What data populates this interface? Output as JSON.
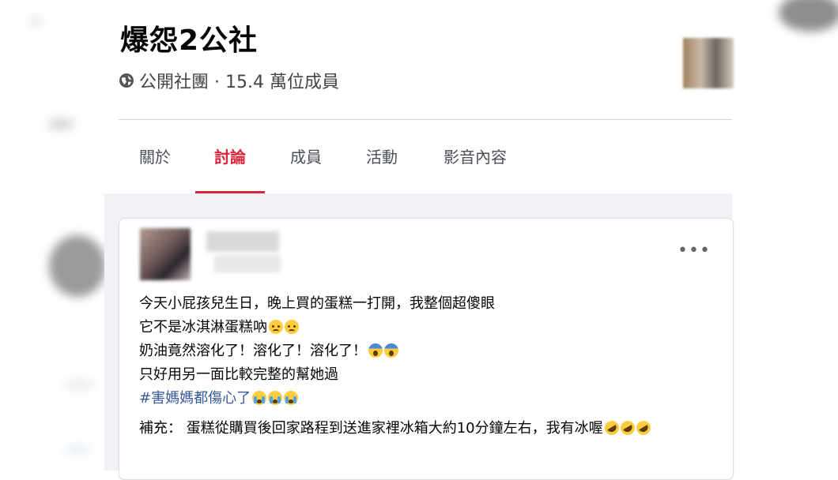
{
  "group": {
    "name": "爆怨2公社",
    "meta": "公開社團 · 15.4 萬位成員"
  },
  "tabs": [
    {
      "label": "關於"
    },
    {
      "label": "討論",
      "active": true
    },
    {
      "label": "成員"
    },
    {
      "label": "活動"
    },
    {
      "label": "影音內容"
    }
  ],
  "post": {
    "more_label": "•••",
    "lines": [
      "今天小屁孩兒生日，晚上買的蛋糕一打開，我整個超傻眼",
      "它不是冰淇淋蛋糕吶",
      "奶油竟然溶化了！溶化了！溶化了！",
      "只好用另一面比較完整的幫她過"
    ],
    "hashtag": "#害媽媽都傷心了",
    "note": "補充： 蛋糕從購買後回家路程到送進家裡冰箱大約10分鐘左右，我有冰喔"
  },
  "colors": {
    "active_tab": "#d8263c",
    "hashtag": "#385898",
    "feed_background": "#f0f2f5"
  },
  "icons": [
    "globe-icon",
    "more-options-icon",
    "emoji-sad",
    "emoji-scream",
    "emoji-crying",
    "emoji-rofl"
  ]
}
